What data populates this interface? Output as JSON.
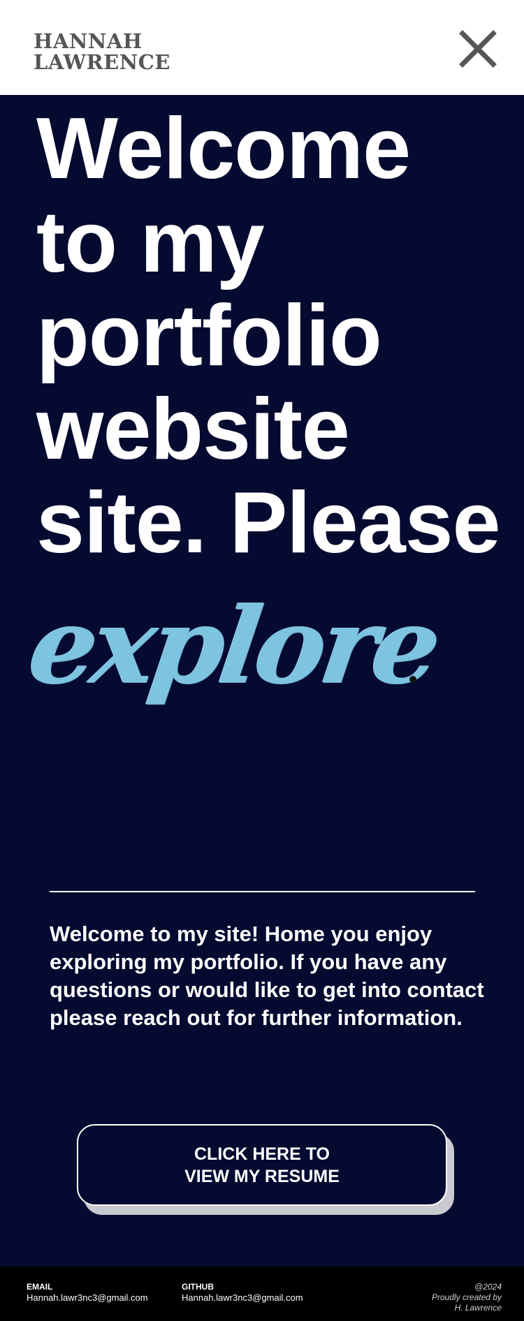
{
  "header": {
    "logo_line1": "HANNAH",
    "logo_line2": "LAWRENCE",
    "close_icon": "close-icon"
  },
  "hero": {
    "headline_lines": [
      "Welcome",
      "to my",
      "portfolio",
      "website",
      "site. Please"
    ],
    "script_word": "explore"
  },
  "intro": {
    "text": "Welcome to my site!  Home you enjoy exploring my portfolio. If you have any questions or would like to get into contact please reach out for further information."
  },
  "resume_button": {
    "line1": "CLICK HERE TO",
    "line2": "VIEW MY RESUME"
  },
  "footer": {
    "email_label": "EMAIL",
    "email_value": "Hannah.lawr3nc3@gmail.com",
    "github_label": "GITHUB",
    "github_value": "Hannah.lawr3nc3@gmail.com",
    "credit_line1": "@2024",
    "credit_line2": "Proudly created by",
    "credit_line3": "H. Lawrence"
  },
  "colors": {
    "background": "#050a30",
    "header_bg": "#ffffff",
    "logo_text": "#555555",
    "accent_script": "#7ec3e0",
    "footer_bg": "#000000"
  }
}
